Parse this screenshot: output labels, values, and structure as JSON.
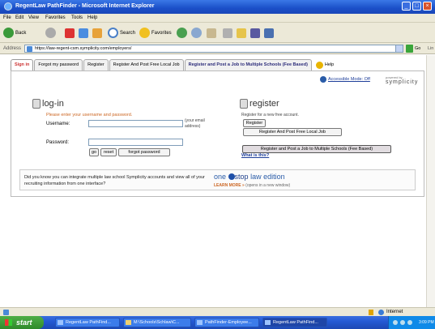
{
  "window": {
    "title": "RegentLaw PathFinder - Microsoft Internet Explorer"
  },
  "menu": [
    "File",
    "Edit",
    "View",
    "Favorites",
    "Tools",
    "Help"
  ],
  "toolbar": {
    "back": "Back",
    "search": "Search",
    "favorites": "Favorites"
  },
  "address": {
    "label": "Address",
    "url": "https://law-regent-csm.symplicity.com/employers/",
    "go": "Go",
    "links": "Lin"
  },
  "tabs": [
    {
      "label": "Sign in"
    },
    {
      "label": "Forgot my password"
    },
    {
      "label": "Register"
    },
    {
      "label": "Register And Post Free Local Job"
    },
    {
      "label": "Register and Post a Job to Multiple Schools (Fee Based)"
    },
    {
      "label": "Help"
    }
  ],
  "header": {
    "accessible": "Accessible Mode: Off",
    "powered_by": "powered by",
    "brand": "symplicity"
  },
  "login": {
    "heading": "log-in",
    "hint": "Please enter your username and password.",
    "username_label": "Username:",
    "username_note": "(your email address)",
    "password_label": "Password:",
    "go": "go",
    "reset": "reset",
    "forgot": "forgot password"
  },
  "register": {
    "heading": "register",
    "hint": "Register for a new free account.",
    "register_btn": "Register",
    "free_job_btn": "Register And Post Free Local Job",
    "fee_btn": "Register and Post a Job to Multiple Schools (Fee Based)",
    "what_is": "What is this?"
  },
  "promo": {
    "text": "Did you know you can integrate multiple law school Symplicity accounts and view all of your recruiting information from one interface?",
    "one": "one",
    "stop": "stop",
    "edition": "law edition",
    "learn_more": "LEARN MORE »",
    "learn_note": "(opens in a new window)"
  },
  "status": {
    "zone": "Internet"
  },
  "taskbar": {
    "start": "start",
    "tasks": [
      "RegentLaw PathFind...",
      "M:\\Schools\\Schlaw\\C...",
      "PathFinder-Employee...",
      "RegentLaw PathFind..."
    ],
    "clock": "3:09 PM"
  }
}
